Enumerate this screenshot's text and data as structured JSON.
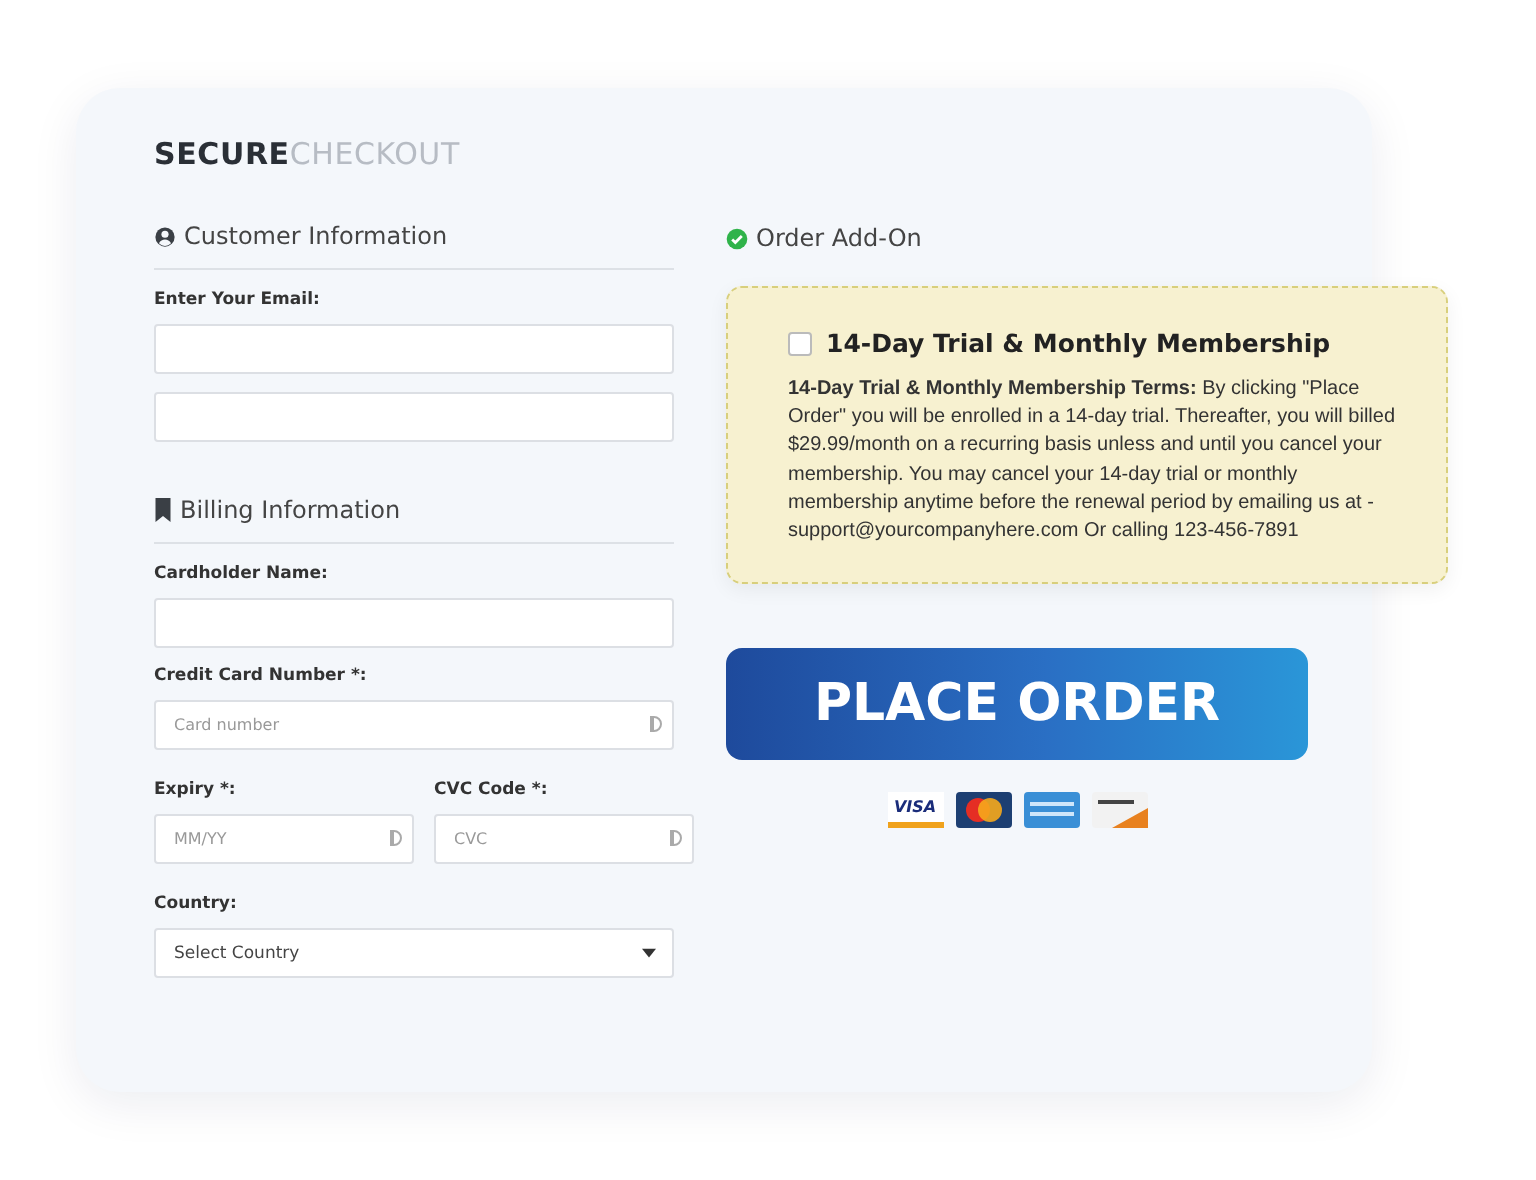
{
  "title": {
    "strong": "SECURE",
    "light": "CHECKOUT"
  },
  "customer": {
    "heading": "Customer Information",
    "email_label": "Enter Your Email:",
    "fields": [
      {
        "kind": "text"
      },
      {
        "kind": "text"
      }
    ]
  },
  "billing": {
    "heading": "Billing Information",
    "fields": [
      {
        "kind": "text",
        "label": "Cardholder Name:"
      },
      {
        "kind": "card",
        "label": "Credit Card Number *:",
        "placeholder": "Card number"
      }
    ],
    "row": [
      {
        "kind": "card",
        "label": "Expiry *:",
        "placeholder": "MM/YY"
      },
      {
        "kind": "card",
        "label": "CVC Code *:",
        "placeholder": "CVC"
      }
    ],
    "country": {
      "label": "Country:",
      "value": "Select Country"
    }
  },
  "addon": {
    "heading": "Order Add-On",
    "checked": false,
    "title": "14-Day Trial & Monthly Membership",
    "terms": "**14-Day Trial & Monthly Membership Terms:** By clicking \"Place Order\" you will be enrolled in a 14-day trial. Thereafter, you will billed $29.99/month on a recurring basis unless and until you cancel your membership. You may cancel your 14-day trial or monthly membership anytime before the renewal period by emailing us at - support@yourcompanyhere.com Or calling 123-456-7891"
  },
  "button": "PLACE ORDER",
  "cards": [
    {
      "kind": "visa",
      "label": "VISA"
    },
    {
      "kind": "mastercard"
    },
    {
      "kind": "amex"
    },
    {
      "kind": "discover"
    }
  ]
}
